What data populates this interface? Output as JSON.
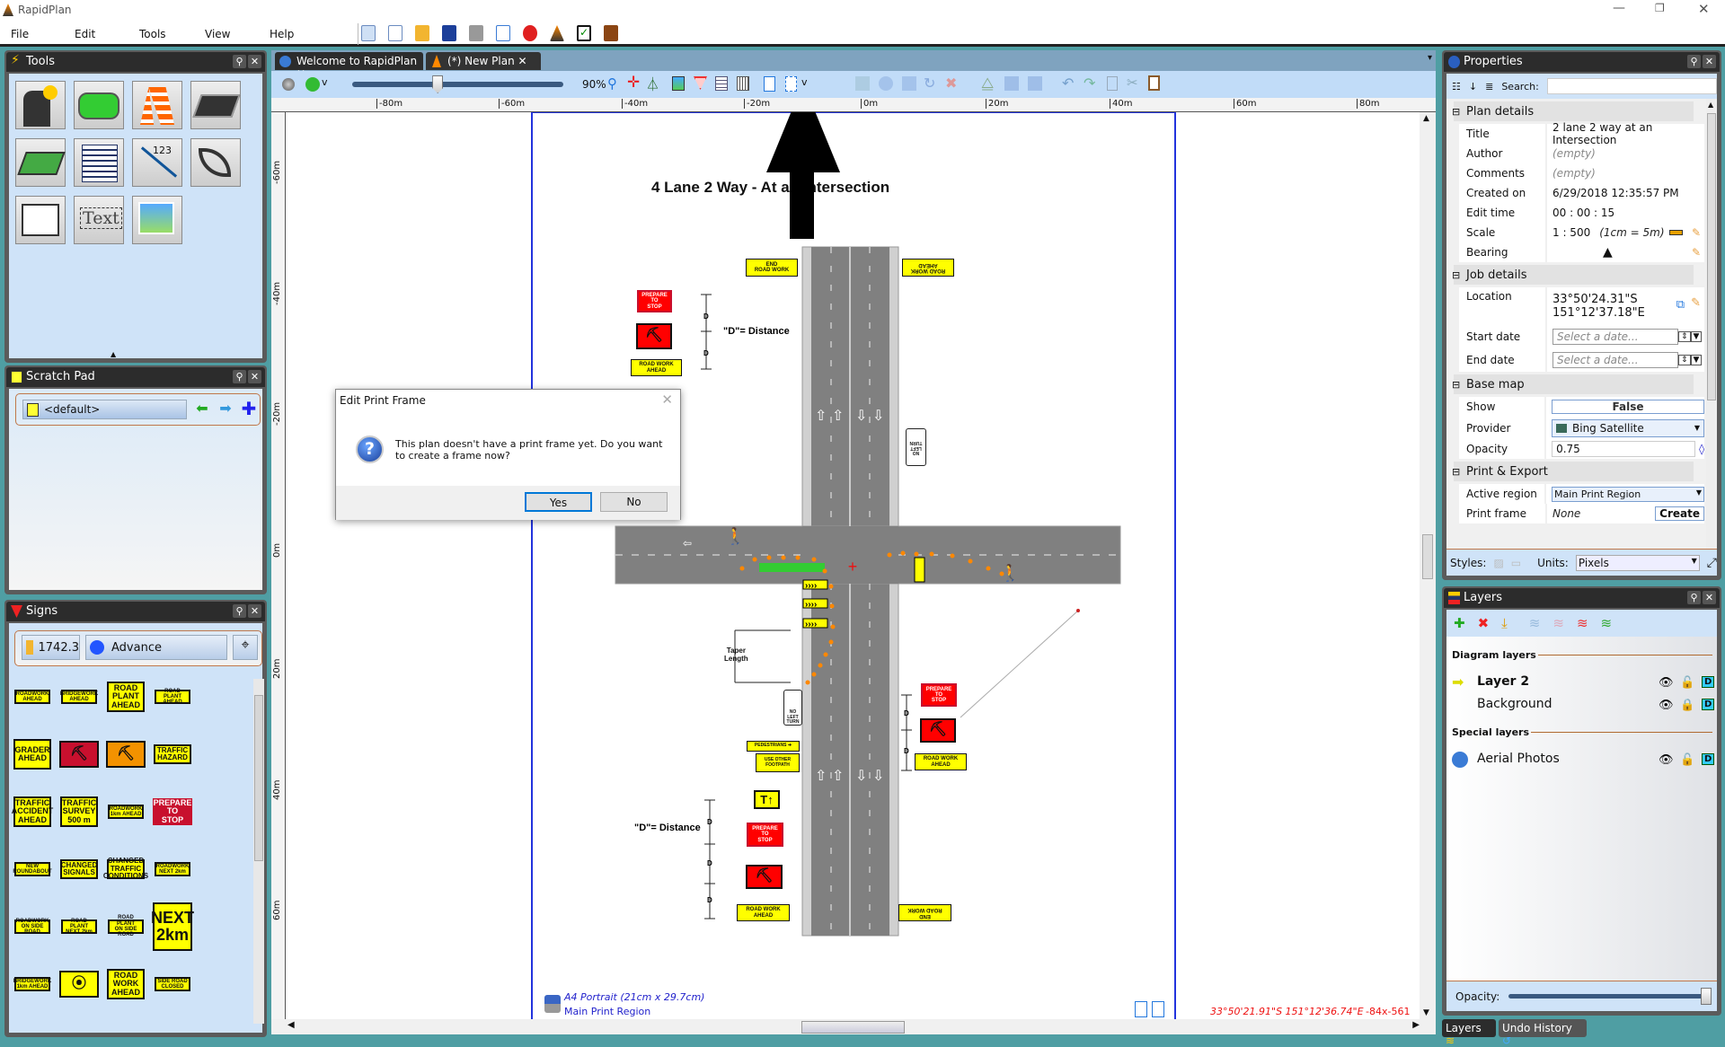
{
  "app": {
    "title": "RapidPlan"
  },
  "menu": [
    "File",
    "Edit",
    "Tools",
    "View",
    "Help"
  ],
  "tools_panel": {
    "title": "Tools",
    "counter_label": "123",
    "text_label": "Text"
  },
  "scratch_pad": {
    "title": "Scratch Pad",
    "current": "<default>"
  },
  "signs_panel": {
    "title": "Signs",
    "code": "1742.3",
    "category": "Advance",
    "signs": [
      {
        "t": "ROADWORK\nAHEAD",
        "s": "sm"
      },
      {
        "t": "BRIDGEWORK\nAHEAD",
        "s": "sm"
      },
      {
        "t": "ROAD\nPLANT\nAHEAD",
        "s": "lg"
      },
      {
        "t": "ROAD PLANT\nAHEAD",
        "s": "sm"
      },
      {
        "t": "GRADER\nAHEAD",
        "s": "lg"
      },
      {
        "t": "",
        "s": "worker-red"
      },
      {
        "t": "",
        "s": "worker-orange"
      },
      {
        "t": "TRAFFIC\nHAZARD",
        "s": "md"
      },
      {
        "t": "TRAFFIC\nACCIDENT\nAHEAD",
        "s": "lg"
      },
      {
        "t": "TRAFFIC\nSURVEY\n500 m",
        "s": "lg"
      },
      {
        "t": "ROADWORK\n1km AHEAD",
        "s": "sm"
      },
      {
        "t": "PREPARE\nTO\nSTOP",
        "s": "red"
      },
      {
        "t": "NEW\nROUNDABOUT",
        "s": "sm"
      },
      {
        "t": "CHANGED\nSIGNALS",
        "s": "md"
      },
      {
        "t": "CHANGED\nTRAFFIC\nCONDITIONS",
        "s": "md"
      },
      {
        "t": "ROADWORK\nNEXT 2km",
        "s": "sm"
      },
      {
        "t": "ROADWORK\nON SIDE ROAD",
        "s": "sm"
      },
      {
        "t": "ROAD PLANT\nNEXT 2km",
        "s": "sm"
      },
      {
        "t": "ROAD PLANT\nON SIDE ROAD",
        "s": "sm"
      },
      {
        "t": "NEXT\n2km",
        "s": "xl"
      },
      {
        "t": "BRIDGEWORK\n1km AHEAD",
        "s": "sm"
      },
      {
        "t": "",
        "s": "signals"
      },
      {
        "t": "ROAD\nWORK\nAHEAD",
        "s": "lg"
      },
      {
        "t": "SIDE ROAD\nCLOSED",
        "s": "sm"
      }
    ]
  },
  "tabs": [
    {
      "label": "Welcome to RapidPlan"
    },
    {
      "label": "(*) New Plan",
      "active": true
    }
  ],
  "doc_toolbar": {
    "zoom": "90%",
    "zoom_slider_percent": 40
  },
  "ruler": {
    "h": [
      "-80m",
      "-60m",
      "-40m",
      "-20m",
      "0m",
      "20m",
      "40m",
      "60m",
      "80m"
    ],
    "v": [
      "-60m",
      "-40m",
      "-20m",
      "0m",
      "20m",
      "40m",
      "60m"
    ]
  },
  "drawing": {
    "title": "4 Lane 2 Way - At an Intersection",
    "distance_label": "\"D\"= Distance",
    "d": "D",
    "taper": "Taper\nLength",
    "signs": {
      "end_road_work_top": "END\nROAD WORK",
      "road_work_ahead_top_right": "ROAD WORK\nAHEAD",
      "prepare_top": "PREPARE\nTO\nSTOP",
      "road_work_ahead_top": "ROAD WORK\nAHEAD",
      "no_left_top": "NO\nLEFT\nTURN",
      "no_left_bottom": "NO\nLEFT\nTURN",
      "pedestrians": "PEDESTRIANS ➔",
      "use_other": "USE OTHER\nFOOTPATH",
      "prepare_bottom": "PREPARE\nTO\nSTOP",
      "road_work_ahead_bottom": "ROAD WORK\nAHEAD",
      "end_road_work_bottom": "END\nROAD WORK",
      "prepare_right": "PREPARE\nTO\nSTOP",
      "road_work_ahead_right": "ROAD WORK\nAHEAD"
    },
    "print_frame": {
      "paper": "A4 Portrait (21cm x 29.7cm)",
      "region": "Main Print Region"
    },
    "cursor_coords": "33°50'21.91\"S 151°12'36.74\"E",
    "cursor_px": "-84x-561"
  },
  "dialog": {
    "title": "Edit Print Frame",
    "message": "This plan doesn't have a print frame yet. Do you want to create a frame now?",
    "yes": "Yes",
    "no": "No"
  },
  "properties": {
    "title": "Properties",
    "search_label": "Search:",
    "search_value": "",
    "sections": {
      "plan": "Plan details",
      "job": "Job details",
      "base": "Base map",
      "print": "Print & Export"
    },
    "plan": {
      "title_k": "Title",
      "title_v": "2 lane 2 way at an Intersection",
      "author_k": "Author",
      "author_v": "(empty)",
      "comments_k": "Comments",
      "comments_v": "(empty)",
      "created_k": "Created on",
      "created_v": "6/29/2018 12:35:57 PM",
      "edit_k": "Edit time",
      "edit_v": "00 : 00 : 15",
      "scale_k": "Scale",
      "scale_v": "1 : 500",
      "scale_note": "(1cm = 5m)",
      "bearing_k": "Bearing"
    },
    "job": {
      "location_k": "Location",
      "lat": "33°50'24.31\"S",
      "lon": "151°12'37.18\"E",
      "start_k": "Start date",
      "end_k": "End date",
      "date_placeholder": "Select a date..."
    },
    "base": {
      "show_k": "Show",
      "show_v": "False",
      "provider_k": "Provider",
      "provider_v": "Bing Satellite",
      "opacity_k": "Opacity",
      "opacity_v": "0.75"
    },
    "print": {
      "region_k": "Active region",
      "region_v": "Main Print Region",
      "frame_k": "Print frame",
      "frame_v": "None",
      "create": "Create"
    },
    "styles_label": "Styles:",
    "units_label": "Units:",
    "units_v": "Pixels"
  },
  "layers": {
    "title": "Layers",
    "diagram": "Diagram layers",
    "special": "Special layers",
    "items": [
      {
        "name": "Layer 2",
        "active": true,
        "locked": false
      },
      {
        "name": "Background",
        "locked": true
      }
    ],
    "special_items": [
      {
        "name": "Aerial Photos",
        "locked": false
      }
    ],
    "opacity_label": "Opacity:",
    "opacity_percent": 100,
    "lock_d": "D"
  },
  "bottom_tabs": [
    "Layers",
    "Undo History"
  ]
}
